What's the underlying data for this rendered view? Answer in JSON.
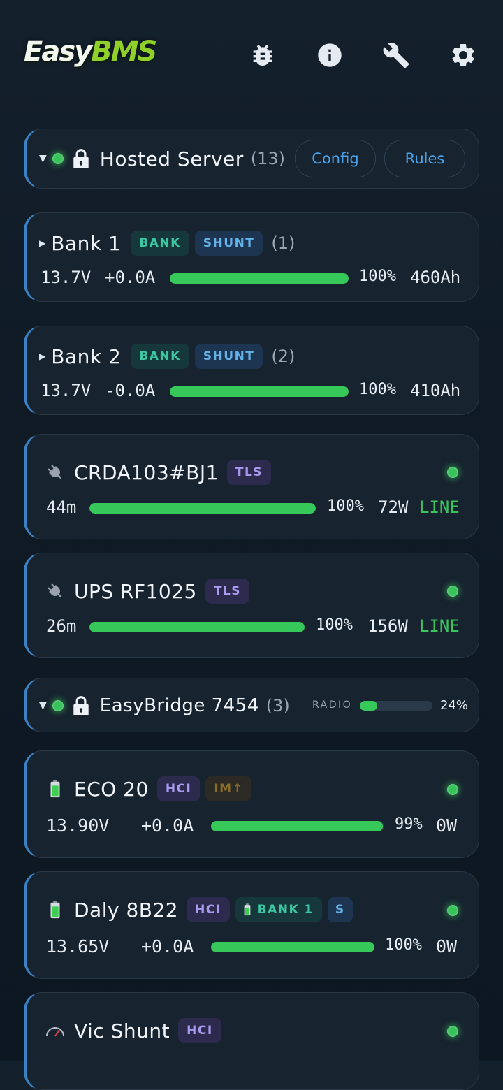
{
  "header": {
    "logo_easy": "Easy",
    "logo_bms": "BMS",
    "icons": [
      "bug-icon",
      "info-icon",
      "wrench-icon",
      "gear-icon"
    ]
  },
  "server": {
    "title": "Hosted Server",
    "count": "(13)",
    "config_label": "Config",
    "rules_label": "Rules"
  },
  "banks": [
    {
      "name": "Bank 1",
      "tag_bank": "BANK",
      "tag_shunt": "SHUNT",
      "count": "(1)",
      "voltage": "13.7V",
      "current": "+0.0A",
      "soc": "100%",
      "capacity": "460Ah",
      "fill": 1.0
    },
    {
      "name": "Bank 2",
      "tag_bank": "BANK",
      "tag_shunt": "SHUNT",
      "count": "(2)",
      "voltage": "13.7V",
      "current": "-0.0A",
      "soc": "100%",
      "capacity": "410Ah",
      "fill": 1.0
    }
  ],
  "ups": [
    {
      "name": "CRDA103#BJ1",
      "tag": "TLS",
      "runtime": "44m",
      "soc": "100%",
      "power": "72W",
      "mode": "LINE",
      "fill": 1.0
    },
    {
      "name": "UPS RF1025",
      "tag": "TLS",
      "runtime": "26m",
      "soc": "100%",
      "power": "156W",
      "mode": "LINE",
      "fill": 1.0
    }
  ],
  "bridge": {
    "title": "EasyBridge 7454",
    "count": "(3)",
    "radio_label": "RADIO",
    "radio_pct": "24%",
    "radio_fill": 0.24
  },
  "devices": [
    {
      "name": "ECO 20",
      "tag_hci": "HCI",
      "tag_im": "IM↑",
      "voltage": "13.90V",
      "current": "+0.0A",
      "soc": "99%",
      "power": "0W",
      "fill": 0.99
    },
    {
      "name": "Daly 8B22",
      "tag_hci": "HCI",
      "tag_bank": "BANK 1",
      "tag_s": "S",
      "voltage": "13.65V",
      "current": "+0.0A",
      "soc": "100%",
      "power": "0W",
      "fill": 1.0
    },
    {
      "name": "Vic Shunt",
      "tag_hci": "HCI"
    }
  ],
  "colors": {
    "accent": "#4aa3ea",
    "green": "#36c95a",
    "card": "#17232f",
    "logo_green": "#8fd12a"
  }
}
